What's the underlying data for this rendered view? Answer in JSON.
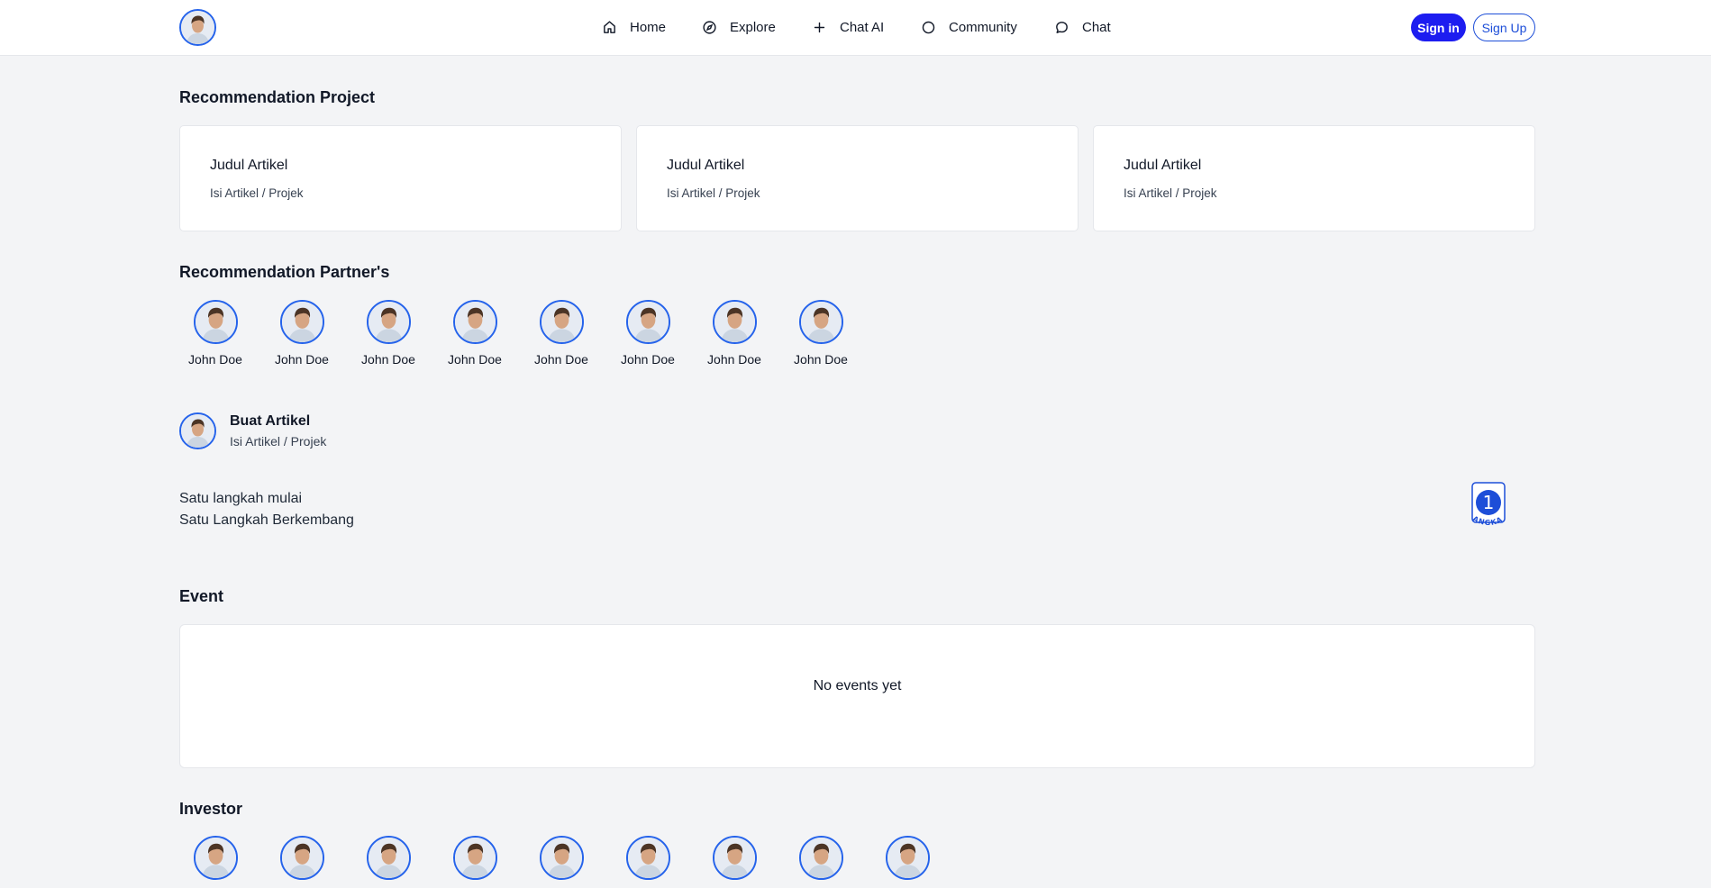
{
  "header": {
    "nav": [
      {
        "label": "Home",
        "icon": "home-icon"
      },
      {
        "label": "Explore",
        "icon": "compass-icon"
      },
      {
        "label": "Chat AI",
        "icon": "plus-icon"
      },
      {
        "label": "Community",
        "icon": "circle-icon"
      },
      {
        "label": "Chat",
        "icon": "chat-bubble-icon"
      }
    ],
    "signin_label": "Sign in",
    "signup_label": "Sign Up"
  },
  "projects": {
    "title": "Recommendation Project",
    "cards": [
      {
        "title": "Judul Artikel",
        "subtitle": "Isi Artikel / Projek"
      },
      {
        "title": "Judul Artikel",
        "subtitle": "Isi Artikel / Projek"
      },
      {
        "title": "Judul Artikel",
        "subtitle": "Isi Artikel / Projek"
      }
    ]
  },
  "partners": {
    "title": "Recommendation Partner's",
    "items": [
      {
        "name": "John Doe"
      },
      {
        "name": "John Doe"
      },
      {
        "name": "John Doe"
      },
      {
        "name": "John Doe"
      },
      {
        "name": "John Doe"
      },
      {
        "name": "John Doe"
      },
      {
        "name": "John Doe"
      },
      {
        "name": "John Doe"
      }
    ]
  },
  "compose": {
    "title": "Buat Artikel",
    "subtitle": "Isi Artikel / Projek"
  },
  "tagline": {
    "line1": "Satu langkah mulai",
    "line2": "Satu Langkah Berkembang",
    "logo_number": "1",
    "logo_text": "LANGKAH"
  },
  "events": {
    "title": "Event",
    "empty_text": "No events yet"
  },
  "investors": {
    "title": "Investor",
    "count": 9
  },
  "colors": {
    "primary": "#1d1df0",
    "accent_border": "#2563eb",
    "background": "#f3f4f6"
  }
}
